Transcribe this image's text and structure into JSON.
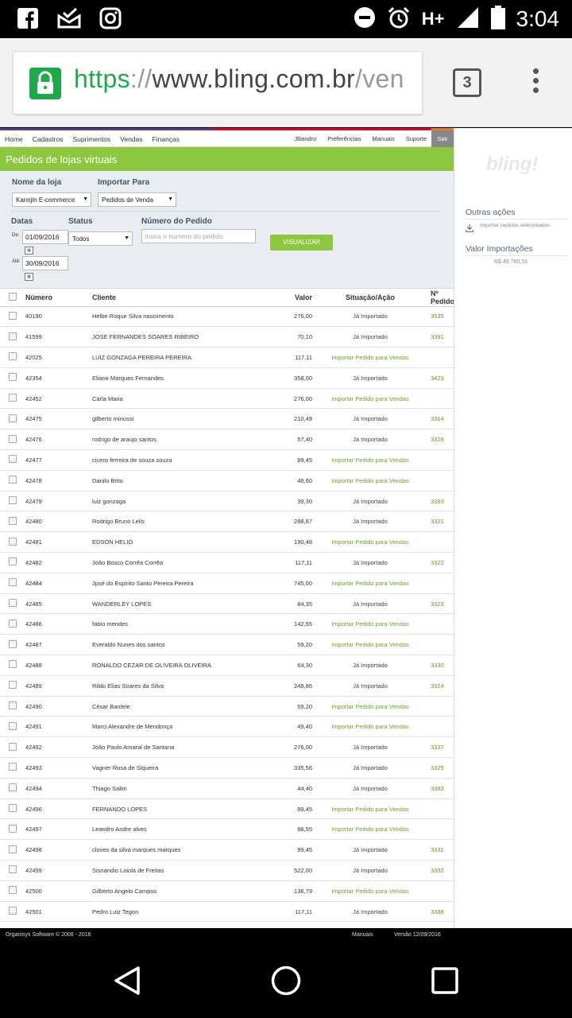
{
  "status_bar": {
    "time": "3:04",
    "network": "H+",
    "left_icons": [
      "facebook-icon",
      "mail-check-icon",
      "instagram-icon"
    ],
    "right_icons": [
      "do-not-disturb-icon",
      "alarm-icon",
      "signal-icon",
      "battery-icon"
    ]
  },
  "browser": {
    "url_https": "https",
    "url_sep": "://",
    "url_host": "www.bling.com.br",
    "url_rest": "/ven",
    "tab_count": "3"
  },
  "nav": {
    "left": [
      "Home",
      "Cadastros",
      "Suprimentos",
      "Vendas",
      "Finanças"
    ],
    "right": [
      "Jlliandro",
      "Preferências",
      "Manuais",
      "Suporte"
    ],
    "logout": "Sair"
  },
  "page_title": "Pedidos de lojas virtuais",
  "filters": {
    "store_label": "Nome da loja",
    "store_value": "Kannjin E-commerce",
    "import_label": "Importar Para",
    "import_value": "Pedidos de Venda",
    "visualize_button": "VISUALIZAR",
    "dates_label": "Datas",
    "from_label": "De:",
    "from_value": "01/09/2016",
    "to_label": "Até:",
    "to_value": "30/09/2016",
    "status_label": "Status",
    "status_value": "Todos",
    "order_label": "Número do Pedido",
    "order_placeholder": "Insira o número do pedido"
  },
  "table": {
    "headers": [
      "Número",
      "Cliente",
      "Valor",
      "Situação/Ação",
      "Nº Pedido"
    ],
    "rows": [
      {
        "numero": "40190",
        "cliente": "Helbe Roque Silva nascimento",
        "valor": "276,00",
        "situacao": "Já Importado",
        "pedido": "3535"
      },
      {
        "numero": "41599",
        "cliente": "JOSE FERNANDES SOARES RIBEIRO",
        "valor": "70,10",
        "situacao": "Já Importado",
        "pedido": "3391"
      },
      {
        "numero": "42025",
        "cliente": "LUIZ GONZAGA PEREIRA PEREIRA",
        "valor": "117,11",
        "situacao": "Importar Pedido para Vendas",
        "pedido": ""
      },
      {
        "numero": "42354",
        "cliente": "Eliane Marques Fernandes",
        "valor": "358,00",
        "situacao": "Já Importado",
        "pedido": "3423"
      },
      {
        "numero": "42452",
        "cliente": "Carla Maria",
        "valor": "276,00",
        "situacao": "Importar Pedido para Vendas",
        "pedido": ""
      },
      {
        "numero": "42475",
        "cliente": "gilberto minussi",
        "valor": "210,49",
        "situacao": "Já Importado",
        "pedido": "3314"
      },
      {
        "numero": "42476",
        "cliente": "rodrigo de araujo santos",
        "valor": "57,40",
        "situacao": "Já Importado",
        "pedido": "3329"
      },
      {
        "numero": "42477",
        "cliente": "cicero ferreira de souza souza",
        "valor": "99,45",
        "situacao": "Importar Pedido para Vendas",
        "pedido": ""
      },
      {
        "numero": "42478",
        "cliente": "Danilo Brito",
        "valor": "46,60",
        "situacao": "Importar Pedido para Vendas",
        "pedido": ""
      },
      {
        "numero": "42479",
        "cliente": "luiz gonzaga",
        "valor": "39,30",
        "situacao": "Já Importado",
        "pedido": "3393"
      },
      {
        "numero": "42480",
        "cliente": "Rodrigo Bruno Lelis",
        "valor": "288,87",
        "situacao": "Já Importado",
        "pedido": "3321"
      },
      {
        "numero": "42481",
        "cliente": "EDSON HELIO",
        "valor": "190,48",
        "situacao": "Importar Pedido para Vendas",
        "pedido": ""
      },
      {
        "numero": "42482",
        "cliente": "João Bosco Corrêa Corrêa",
        "valor": "117,11",
        "situacao": "Já Importado",
        "pedido": "3322"
      },
      {
        "numero": "42484",
        "cliente": "Jpsé do Espirito Santo Pereira Pereira",
        "valor": "745,00",
        "situacao": "Importar Pedido para Vendas",
        "pedido": ""
      },
      {
        "numero": "42485",
        "cliente": "WANDERLEY LOPES",
        "valor": "84,35",
        "situacao": "Já Importado",
        "pedido": "3323"
      },
      {
        "numero": "42486",
        "cliente": "fabio mendes",
        "valor": "142,55",
        "situacao": "Importar Pedido para Vendas",
        "pedido": ""
      },
      {
        "numero": "42487",
        "cliente": "Everaldo Nunes dos santos",
        "valor": "59,20",
        "situacao": "Importar Pedido para Vendas",
        "pedido": ""
      },
      {
        "numero": "42488",
        "cliente": "RONALDO CEZAR DE OLIVEIRA OLIVEIRA",
        "valor": "64,30",
        "situacao": "Já Importado",
        "pedido": "3330"
      },
      {
        "numero": "42489",
        "cliente": "Rildo Elias Soares da Silva",
        "valor": "248,86",
        "situacao": "Já Importado",
        "pedido": "3324"
      },
      {
        "numero": "42490",
        "cliente": "César Bardele",
        "valor": "59,20",
        "situacao": "Importar Pedido para Vendas",
        "pedido": ""
      },
      {
        "numero": "42491",
        "cliente": "Marci Alexandre de Mendonça",
        "valor": "49,40",
        "situacao": "Importar Pedido para Vendas",
        "pedido": ""
      },
      {
        "numero": "42492",
        "cliente": "João Paulo Amaral de Santana",
        "valor": "276,00",
        "situacao": "Já Importado",
        "pedido": "3337"
      },
      {
        "numero": "42493",
        "cliente": "Vagner Rosa de Siqueira",
        "valor": "335,56",
        "situacao": "Já Importado",
        "pedido": "3325"
      },
      {
        "numero": "42494",
        "cliente": "Thiago Salim",
        "valor": "44,40",
        "situacao": "Já Importado",
        "pedido": "3383"
      },
      {
        "numero": "42496",
        "cliente": "FERNANDO LOPES",
        "valor": "99,45",
        "situacao": "Importar Pedido para Vendas",
        "pedido": ""
      },
      {
        "numero": "42497",
        "cliente": "Leandro Andre alves",
        "valor": "86,55",
        "situacao": "Importar Pedido para Vendas",
        "pedido": ""
      },
      {
        "numero": "42498",
        "cliente": "cloves da silva marques marques",
        "valor": "99,45",
        "situacao": "Já Importado",
        "pedido": "3331"
      },
      {
        "numero": "42499",
        "cliente": "Sisnandio Loiola de Freitas",
        "valor": "522,00",
        "situacao": "Já Importado",
        "pedido": "3332"
      },
      {
        "numero": "42500",
        "cliente": "Gilberto Angelo Campos",
        "valor": "136,79",
        "situacao": "Importar Pedido para Vendas",
        "pedido": ""
      },
      {
        "numero": "42501",
        "cliente": "Pedro Luiz Tegon",
        "valor": "117,11",
        "situacao": "Já Importado",
        "pedido": "3338"
      }
    ]
  },
  "sidebar": {
    "logo": "bling!",
    "other_actions": "Outras ações",
    "import_selected": "Importar pedidos selecionados",
    "import_value_label": "Valor Importações",
    "import_value": "R$ 46.760,16"
  },
  "footer": {
    "copyright": "Organisys Software © 2008 - 2016",
    "manuals": "Manuais",
    "version": "Versão 12/09/2016"
  },
  "colors": {
    "accent_green": "#8dc63f",
    "link_green": "#6da22a",
    "https_green": "#1eaa4a"
  }
}
